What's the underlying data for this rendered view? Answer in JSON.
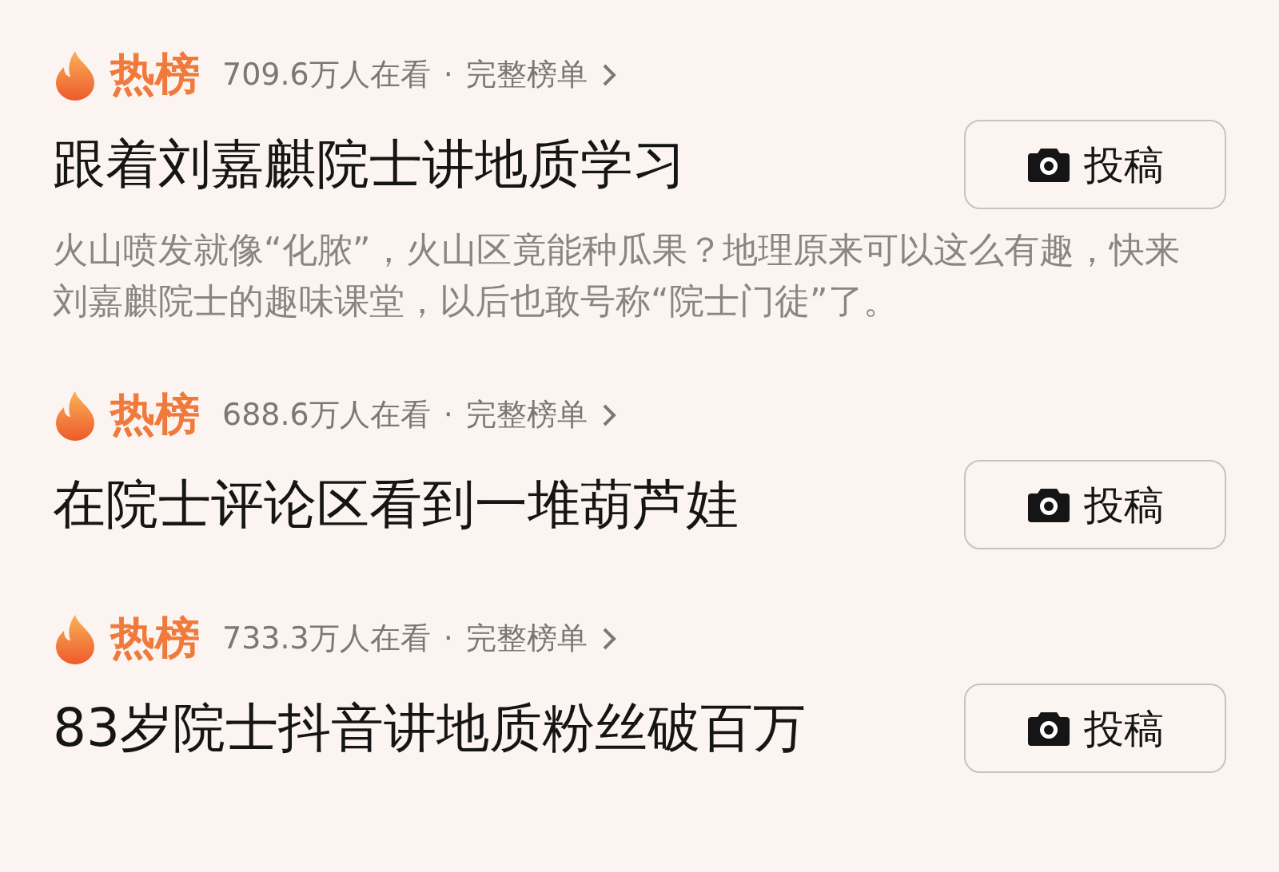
{
  "items": [
    {
      "badge": "热榜",
      "views": "709.6万人在看",
      "separator": "·",
      "link": "完整榜单",
      "title": "跟着刘嘉麒院士讲地质学习",
      "button": "投稿",
      "description": "火山喷发就像“化脓”，火山区竟能种瓜果？地理原来可以这么有趣，快来刘嘉麒院士的趣味课堂，以后也敢号称“院士门徒”了。"
    },
    {
      "badge": "热榜",
      "views": "688.6万人在看",
      "separator": "·",
      "link": "完整榜单",
      "title": "在院士评论区看到一堆葫芦娃",
      "button": "投稿"
    },
    {
      "badge": "热榜",
      "views": "733.3万人在看",
      "separator": "·",
      "link": "完整榜单",
      "title": "83岁院士抖音讲地质粉丝破百万",
      "button": "投稿"
    }
  ]
}
